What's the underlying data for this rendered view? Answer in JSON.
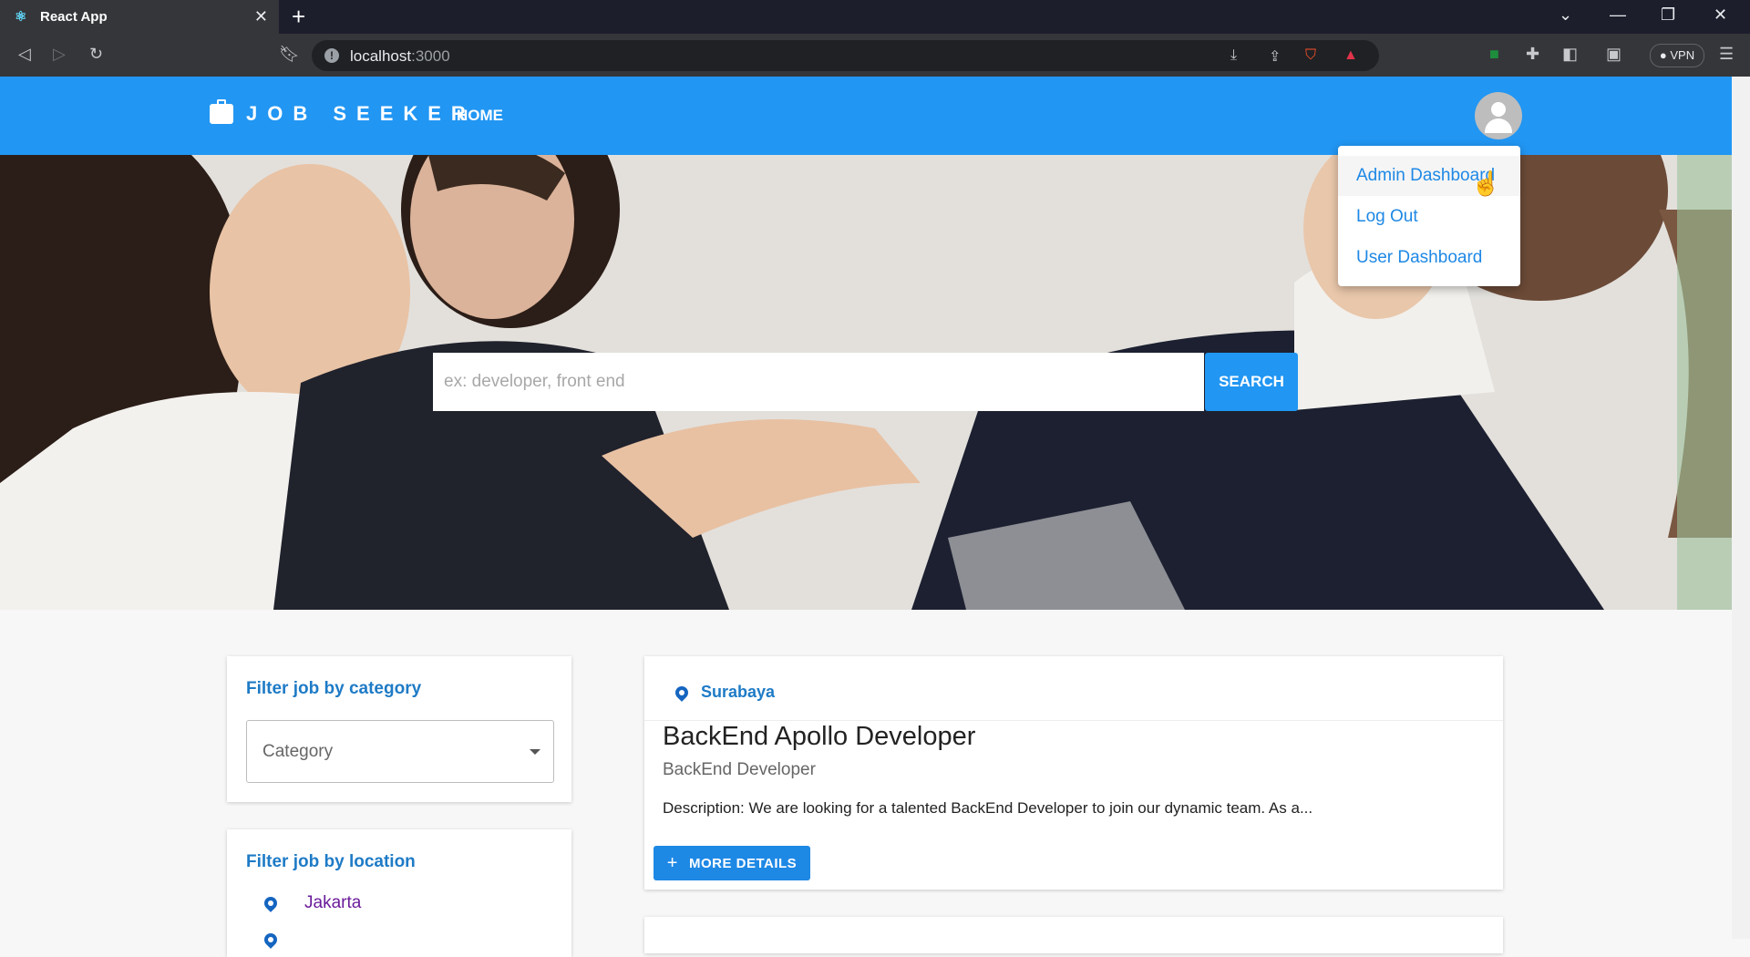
{
  "browser": {
    "tab_title": "React App",
    "url_host": "localhost",
    "url_port": ":3000",
    "vpn_label": "VPN"
  },
  "header": {
    "logo_text": "JOB SEEKER",
    "nav_home": "HOME",
    "brand_color": "#2196f3"
  },
  "user_menu": {
    "items": [
      {
        "label": "Admin Dashboard"
      },
      {
        "label": "Log Out"
      },
      {
        "label": "User Dashboard"
      }
    ]
  },
  "search": {
    "placeholder": "ex: developer, front end",
    "button_label": "SEARCH"
  },
  "filters": {
    "category_title": "Filter job by category",
    "category_placeholder": "Category",
    "location_title": "Filter job by location",
    "locations": [
      "Jakarta"
    ]
  },
  "jobs": [
    {
      "location": "Surabaya",
      "title": "BackEnd Apollo Developer",
      "category": "BackEnd Developer",
      "description": "Description: We are looking for a talented BackEnd Developer to join our dynamic team. As a...",
      "button_label": "MORE DETAILS"
    }
  ]
}
